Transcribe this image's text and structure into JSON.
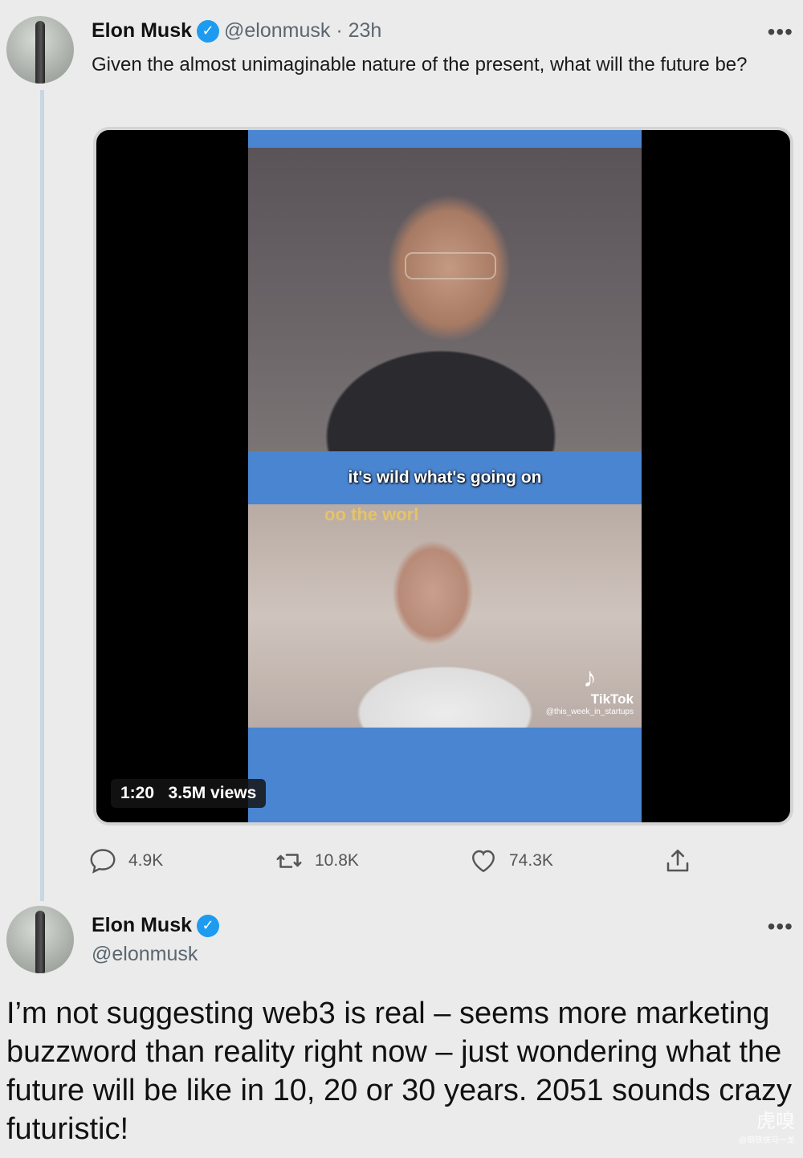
{
  "tweet": {
    "author_name": "Elon Musk",
    "handle": "@elonmusk",
    "time": "23h",
    "handle_time": "@elonmusk · 23h",
    "text": "Given the almost unimaginable nature of the present, what will the future be?",
    "more": "•••",
    "video": {
      "caption": "it's wild what's going on",
      "overlay_fragment": "oo the worl",
      "duration": "1:20",
      "views": "3.5M views",
      "meta": "1:20   3.5M views",
      "tiktok_label": "TikTok",
      "tiktok_user": "@this_week_in_startups"
    },
    "actions": {
      "replies": "4.9K",
      "retweets": "10.8K",
      "likes": "74.3K"
    }
  },
  "reply": {
    "author_name": "Elon Musk",
    "handle": "@elonmusk",
    "more": "•••",
    "text": "I’m not suggesting web3 is real – seems more marketing buzzword than reality right now – just wondering what the future will be like in 10, 20 or 30 years. 2051 sounds crazy futuristic!"
  },
  "watermark": {
    "logo": "虎嗅",
    "sub": "@钢铁侠马一龙"
  },
  "colors": {
    "background": "#ebebeb",
    "verified": "#1d9bf0",
    "video_band": "#4a85d1",
    "thread_line": "#c9d6e3"
  }
}
